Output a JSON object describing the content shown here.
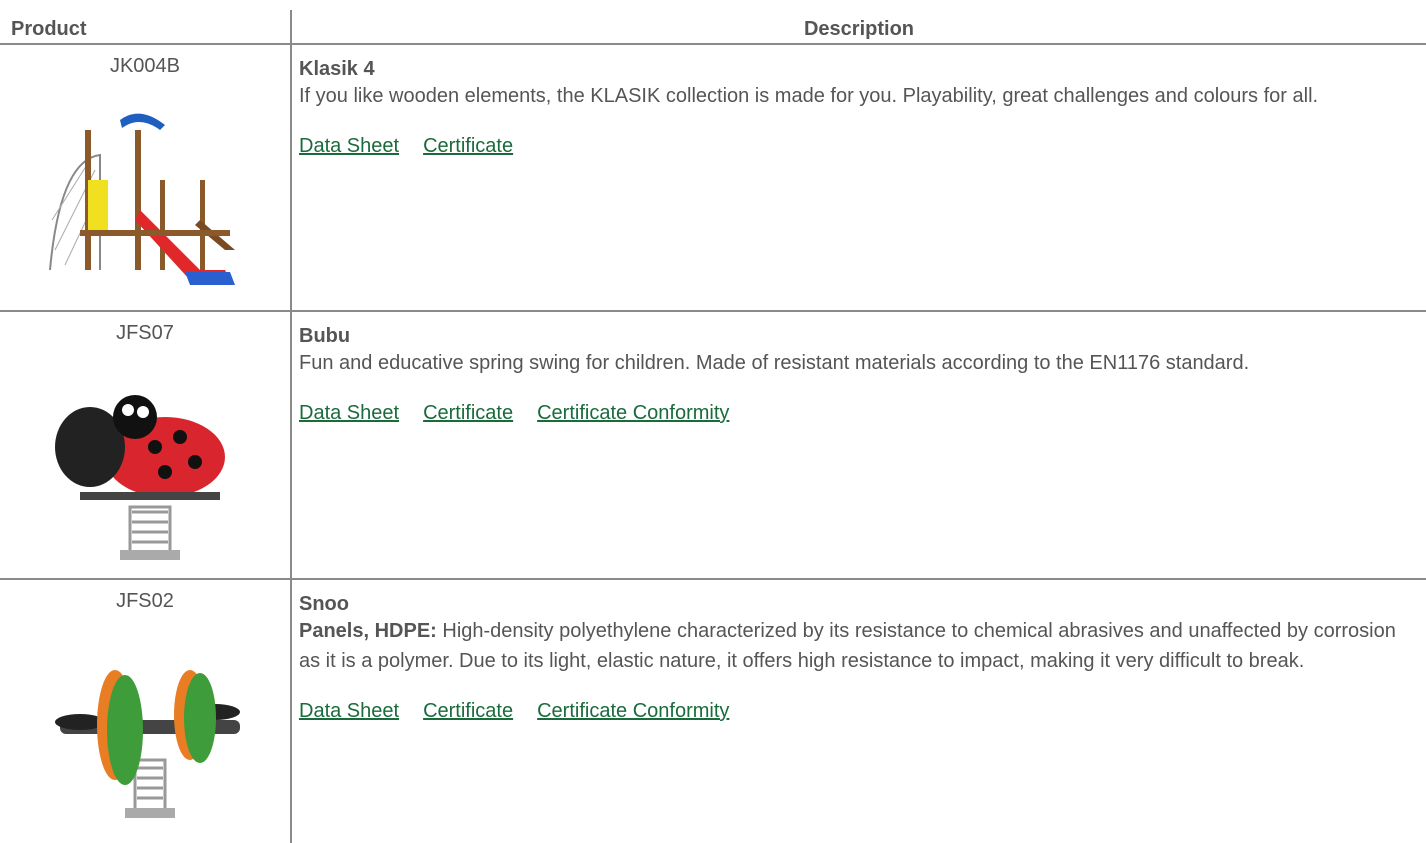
{
  "table": {
    "header": {
      "product": "Product",
      "description": "Description"
    },
    "rows": [
      {
        "code": "JK004B",
        "name": "Klasik 4",
        "description": "If you like wooden elements, the KLASIK collection is made for you. Playability, great challenges and colours for all.",
        "links": [
          "Data Sheet",
          "Certificate"
        ]
      },
      {
        "code": "JFS07",
        "name": "Bubu",
        "description": "Fun and educative spring swing for children. Made of resistant materials according to the EN1176 standard.",
        "links": [
          "Data Sheet",
          "Certificate",
          "Certificate Conformity"
        ]
      },
      {
        "code": "JFS02",
        "name": "Snoo",
        "description_bold": "Panels, HDPE:",
        "description": "High-density polyethylene characterized by its resistance to chemical abrasives and unaffected by corrosion as it is a polymer. Due to its light, elastic nature, it offers high resistance to impact, making it very difficult to break.",
        "links": [
          "Data Sheet",
          "Certificate",
          "Certificate Conformity"
        ]
      }
    ]
  },
  "colors": {
    "text": "#555555",
    "link": "#1a6b3c",
    "rule": "#8a8a8a"
  }
}
